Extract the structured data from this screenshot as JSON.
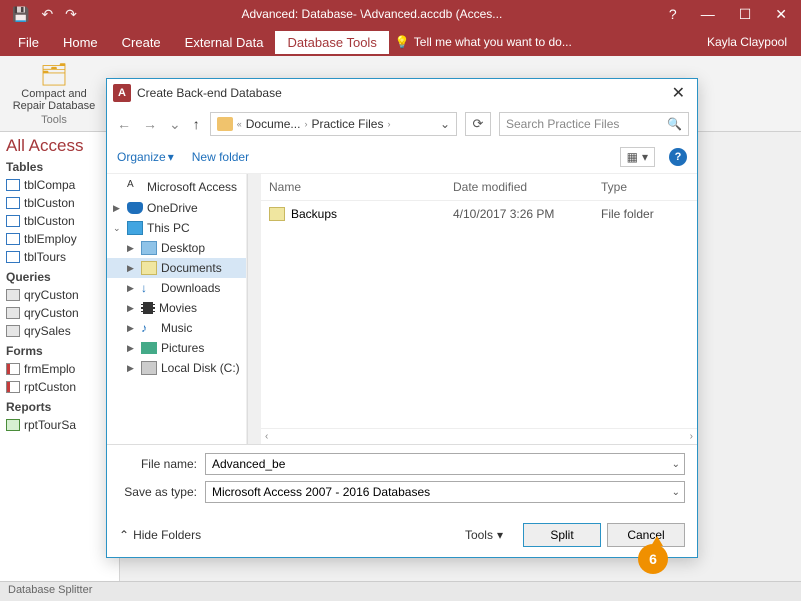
{
  "title": "Advanced: Database- \\Advanced.accdb (Acces...",
  "user": "Kayla Claypool",
  "ribbon": {
    "tabs": [
      "File",
      "Home",
      "Create",
      "External Data",
      "Database Tools"
    ],
    "active": 4,
    "tell_placeholder": "Tell me what you want to do..."
  },
  "toolbar": {
    "compact_l1": "Compact and",
    "compact_l2": "Repair Database",
    "group": "Tools"
  },
  "nav": {
    "heading": "All Access",
    "sections": [
      {
        "title": "Tables",
        "items": [
          "tblCompa",
          "tblCuston",
          "tblCuston",
          "tblEmploy",
          "tblTours"
        ],
        "type": "tbl"
      },
      {
        "title": "Queries",
        "items": [
          "qryCuston",
          "qryCuston",
          "qrySales"
        ],
        "type": "qry"
      },
      {
        "title": "Forms",
        "items": [
          "frmEmplo",
          "rptCuston"
        ],
        "type": "frm"
      },
      {
        "title": "Reports",
        "items": [
          "rptTourSa"
        ],
        "type": "rpt"
      }
    ]
  },
  "dialog": {
    "title": "Create Back-end Database",
    "breadcrumb": [
      "Docume...",
      "Practice Files"
    ],
    "search_placeholder": "Search Practice Files",
    "organize": "Organize",
    "newfolder": "New folder",
    "tree": [
      {
        "label": "Microsoft Access",
        "icon": "aicon",
        "indent": 0,
        "exp": ""
      },
      {
        "label": "OneDrive",
        "icon": "od",
        "indent": 0,
        "exp": "▶"
      },
      {
        "label": "This PC",
        "icon": "pc",
        "indent": 0,
        "exp": "⌄"
      },
      {
        "label": "Desktop",
        "icon": "fld",
        "indent": 1,
        "exp": "▶"
      },
      {
        "label": "Documents",
        "icon": "fld2",
        "indent": 1,
        "exp": "▶",
        "sel": true
      },
      {
        "label": "Downloads",
        "icon": "dn",
        "indent": 1,
        "exp": "▶"
      },
      {
        "label": "Movies",
        "icon": "mov",
        "indent": 1,
        "exp": "▶"
      },
      {
        "label": "Music",
        "icon": "mus",
        "indent": 1,
        "exp": "▶"
      },
      {
        "label": "Pictures",
        "icon": "pic",
        "indent": 1,
        "exp": "▶"
      },
      {
        "label": "Local Disk (C:)",
        "icon": "drv",
        "indent": 1,
        "exp": "▶"
      }
    ],
    "columns": {
      "name": "Name",
      "date": "Date modified",
      "type": "Type"
    },
    "rows": [
      {
        "name": "Backups",
        "date": "4/10/2017 3:26 PM",
        "type": "File folder"
      }
    ],
    "file_label": "File name:",
    "file_value": "Advanced_be",
    "type_label": "Save as type:",
    "type_value": "Microsoft Access 2007 - 2016 Databases",
    "hide_folders": "Hide Folders",
    "tools": "Tools",
    "split": "Split",
    "cancel": "Cancel"
  },
  "status": "Database Splitter",
  "callout": "6"
}
